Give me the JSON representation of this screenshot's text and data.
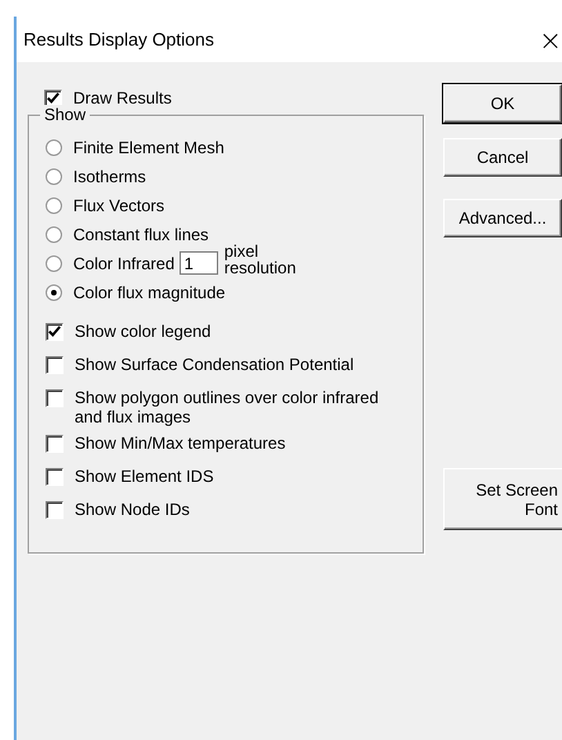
{
  "window": {
    "title": "Results Display Options",
    "close": "×"
  },
  "draw_results": {
    "label": "Draw Results",
    "checked": true
  },
  "group": {
    "title": "Show",
    "items": [
      {
        "kind": "radio",
        "label": "Finite Element Mesh",
        "selected": false
      },
      {
        "kind": "radio",
        "label": "Isotherms",
        "selected": false
      },
      {
        "kind": "radio",
        "label": "Flux Vectors",
        "selected": false
      },
      {
        "kind": "radio",
        "label": "Constant flux lines",
        "selected": false
      },
      {
        "kind": "radio-field",
        "label": "Color Infrared",
        "selected": false,
        "value": "1",
        "suffix": [
          "pixel",
          "resolution"
        ]
      },
      {
        "kind": "radio",
        "label": "Color flux magnitude",
        "selected": true
      },
      {
        "kind": "checkbox",
        "label": "Show color legend",
        "checked": true
      },
      {
        "kind": "checkbox",
        "label": "Show Surface Condensation Potential",
        "checked": false
      },
      {
        "kind": "checkbox",
        "label": "Show polygon outlines over color infrared and flux images",
        "checked": false
      },
      {
        "kind": "checkbox",
        "label": "Show Min/Max temperatures",
        "checked": false
      },
      {
        "kind": "checkbox",
        "label": "Show Element IDS",
        "checked": false
      },
      {
        "kind": "checkbox",
        "label": "Show Node IDs",
        "checked": false
      }
    ]
  },
  "buttons": [
    "OK",
    "Cancel",
    "Advanced..."
  ],
  "font_button": "Set Screen Font"
}
